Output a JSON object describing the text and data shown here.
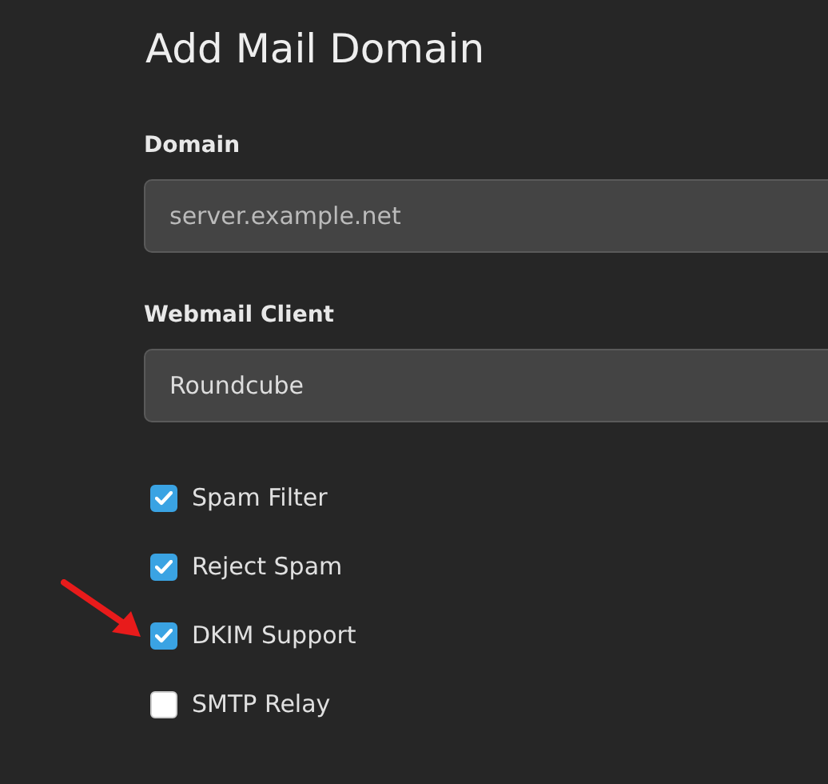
{
  "title": "Add Mail Domain",
  "fields": [
    {
      "kind": "text",
      "label": "Domain",
      "placeholder": "server.example.net"
    },
    {
      "kind": "select",
      "label": "Webmail Client",
      "value": "Roundcube"
    }
  ],
  "options": [
    {
      "label": "Spam Filter",
      "checked": true
    },
    {
      "label": "Reject Spam",
      "checked": true
    },
    {
      "label": "DKIM Support",
      "checked": true,
      "annotated": true
    },
    {
      "label": "SMTP Relay",
      "checked": false
    }
  ]
}
